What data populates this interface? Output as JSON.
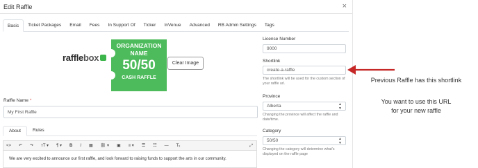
{
  "modal": {
    "title": "Edit Raffle",
    "close_symbol": "×"
  },
  "tabs": [
    {
      "label": "Basic",
      "active": true
    },
    {
      "label": "Ticket Packages"
    },
    {
      "label": "Email"
    },
    {
      "label": "Fees"
    },
    {
      "label": "In Support Of"
    },
    {
      "label": "Ticker"
    },
    {
      "label": "InVenue"
    },
    {
      "label": "Advanced"
    },
    {
      "label": "RB Admin Settings"
    },
    {
      "label": "Tags"
    }
  ],
  "logo": {
    "brand_prefix": "raffle",
    "brand_suffix": "box",
    "ticket_line1": "ORGANIZATION",
    "ticket_line2": "NAME",
    "ticket_big": "50/50",
    "ticket_bottom": "CASH RAFFLE",
    "brand_color": "#4dbb5b"
  },
  "clear_image_label": "Clear Image",
  "raffle_name": {
    "label": "Raffle Name",
    "required_mark": "*",
    "value": "My First Raffle"
  },
  "description_tabs": [
    {
      "label": "About",
      "active": true
    },
    {
      "label": "Rules"
    }
  ],
  "editor": {
    "toolbar": [
      {
        "name": "code-view-icon",
        "glyph": "<>"
      },
      {
        "name": "undo-icon",
        "glyph": "↶"
      },
      {
        "name": "redo-icon",
        "glyph": "↷"
      },
      {
        "name": "font-size-icon",
        "glyph": "ᴛT ▾"
      },
      {
        "name": "paragraph-icon",
        "glyph": "¶ ▾"
      },
      {
        "name": "bold-icon",
        "glyph": "B"
      },
      {
        "name": "italic-icon",
        "glyph": "I"
      },
      {
        "name": "table-icon",
        "glyph": "▦"
      },
      {
        "name": "link-icon",
        "glyph": "⛓ ▾"
      },
      {
        "name": "image-icon",
        "glyph": "▣"
      },
      {
        "name": "align-icon",
        "glyph": "≡ ▾"
      },
      {
        "name": "unordered-list-icon",
        "glyph": "☰"
      },
      {
        "name": "ordered-list-icon",
        "glyph": "☷"
      },
      {
        "name": "horizontal-rule-icon",
        "glyph": "—"
      },
      {
        "name": "clear-format-icon",
        "glyph": "Tₓ"
      }
    ],
    "expand_glyph": "⤢",
    "content": "We are very excited to announce our first raffle, and look forward to raising funds to support the arts in our community."
  },
  "license": {
    "label": "License Number",
    "value": "9000"
  },
  "shortlink": {
    "label": "Shortlink",
    "value": "create-a-raffle",
    "help": "The shortlink will be used for the custom section of your raffle url."
  },
  "province": {
    "label": "Province",
    "value": "Alberta",
    "help": "Changing the province will affect the raffle and date/time."
  },
  "category": {
    "label": "Category",
    "value": "50/50",
    "help": "Changing the category will determine what's displayed on the raffle page"
  },
  "annotations": {
    "arrow_color": "#c62828",
    "note1": "Previous Raffle has this shortlink",
    "note2_line1": "You want to use this URL",
    "note2_line2": "for your new raffle"
  }
}
